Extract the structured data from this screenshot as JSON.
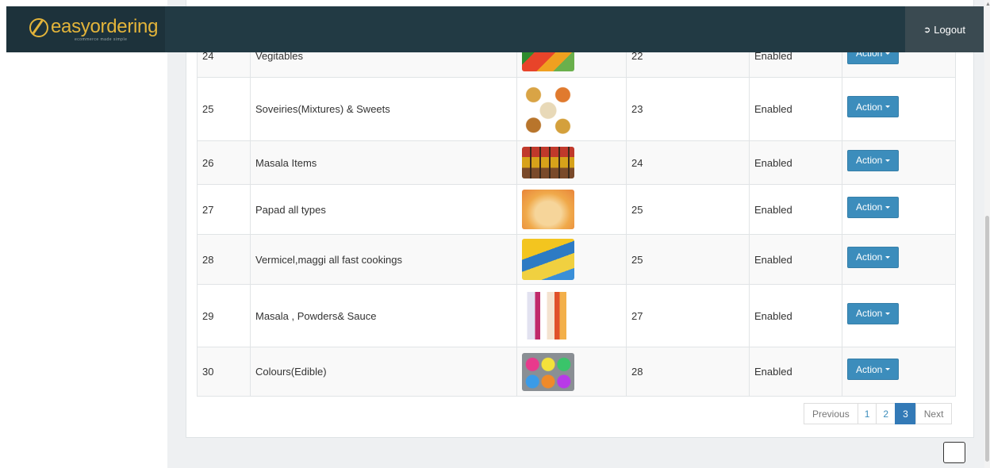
{
  "brand": {
    "name": "easyordering",
    "tagline": "ecommerce made simple"
  },
  "header": {
    "logout_label": "Logout"
  },
  "table": {
    "rows": [
      {
        "id": "24",
        "name": "Vegitables",
        "image": "vegetables-thumbnail",
        "order": "22",
        "status": "Enabled",
        "action": "Action"
      },
      {
        "id": "25",
        "name": "Soveiries(Mixtures) & Sweets",
        "image": "sweets-thumbnail",
        "order": "23",
        "status": "Enabled",
        "action": "Action"
      },
      {
        "id": "26",
        "name": "Masala Items",
        "image": "masala-thumbnail",
        "order": "24",
        "status": "Enabled",
        "action": "Action"
      },
      {
        "id": "27",
        "name": "Papad all types",
        "image": "papad-thumbnail",
        "order": "25",
        "status": "Enabled",
        "action": "Action"
      },
      {
        "id": "28",
        "name": "Vermicel,maggi all fast cookings",
        "image": "vermicelli-thumbnail",
        "order": "25",
        "status": "Enabled",
        "action": "Action"
      },
      {
        "id": "29",
        "name": "Masala , Powders& Sauce",
        "image": "powders-thumbnail",
        "order": "27",
        "status": "Enabled",
        "action": "Action"
      },
      {
        "id": "30",
        "name": "Colours(Edible)",
        "image": "colours-thumbnail",
        "order": "28",
        "status": "Enabled",
        "action": "Action"
      }
    ]
  },
  "pagination": {
    "previous": "Previous",
    "pages": [
      "1",
      "2",
      "3"
    ],
    "active": "3",
    "next": "Next"
  },
  "colors": {
    "header_bg": "#223a44",
    "brand_accent": "#e3b43a",
    "action_button": "#3c8dbc",
    "active_page": "#337ab7"
  }
}
